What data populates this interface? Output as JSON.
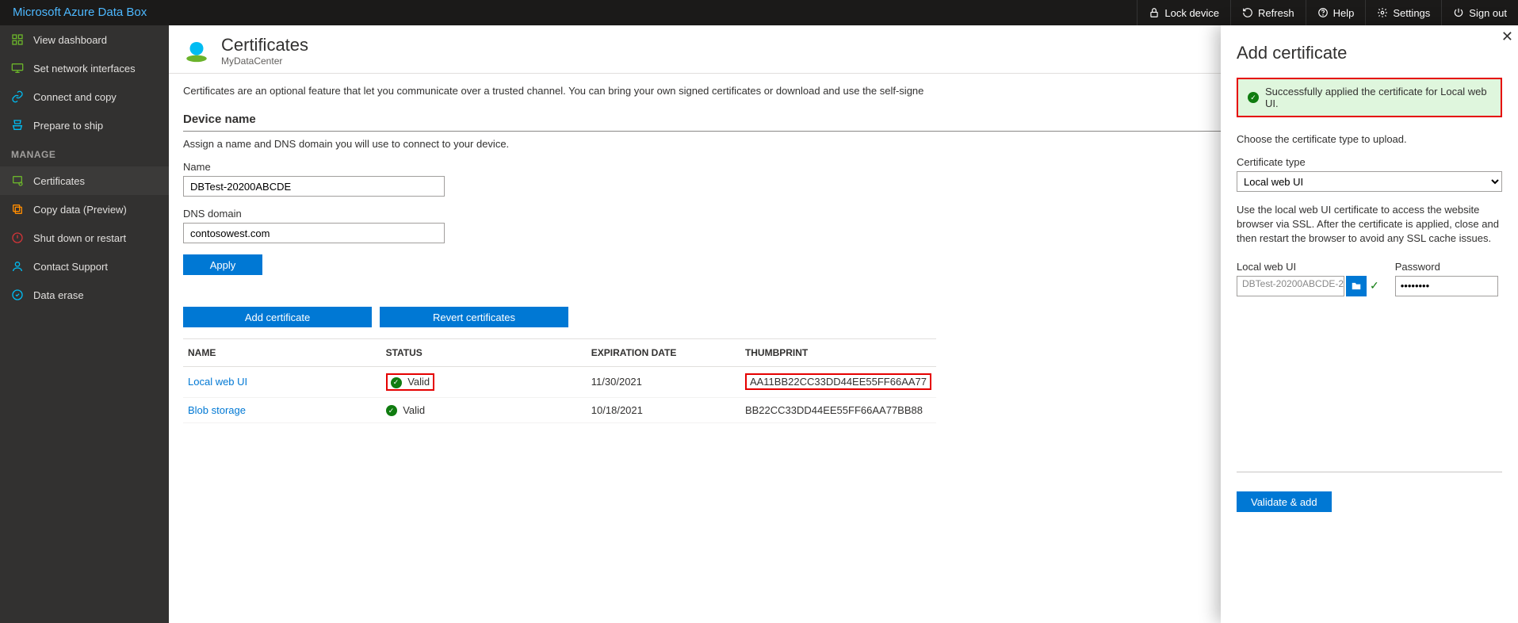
{
  "brand": "Microsoft Azure Data Box",
  "topbar": [
    {
      "label": "Lock device",
      "icon": "lock"
    },
    {
      "label": "Refresh",
      "icon": "refresh"
    },
    {
      "label": "Help",
      "icon": "help"
    },
    {
      "label": "Settings",
      "icon": "settings"
    },
    {
      "label": "Sign out",
      "icon": "signout"
    }
  ],
  "sidebar": {
    "manage_label": "MANAGE",
    "items_top": [
      {
        "label": "View dashboard",
        "icon": "dashboard",
        "color": "#6bb32b"
      },
      {
        "label": "Set network interfaces",
        "icon": "network",
        "color": "#6bb32b"
      },
      {
        "label": "Connect and copy",
        "icon": "chain",
        "color": "#00bcf2"
      },
      {
        "label": "Prepare to ship",
        "icon": "ship",
        "color": "#00bcf2"
      }
    ],
    "items_manage": [
      {
        "label": "Certificates",
        "icon": "cert",
        "color": "#6bb32b",
        "active": true
      },
      {
        "label": "Copy data (Preview)",
        "icon": "copy",
        "color": "#ff8c00"
      },
      {
        "label": "Shut down or restart",
        "icon": "power",
        "color": "#d13438"
      },
      {
        "label": "Contact Support",
        "icon": "support",
        "color": "#00bcf2"
      },
      {
        "label": "Data erase",
        "icon": "erase",
        "color": "#00bcf2"
      }
    ]
  },
  "page": {
    "title": "Certificates",
    "subtitle": "MyDataCenter",
    "intro": "Certificates are an optional feature that let you communicate over a trusted channel. You can bring your own signed certificates or download and use the self-signe",
    "device_section": "Device name",
    "device_desc": "Assign a name and DNS domain you will use to connect to your device.",
    "name_label": "Name",
    "name_value": "DBTest-20200ABCDE",
    "dns_label": "DNS domain",
    "dns_value": "contosowest.com",
    "apply_label": "Apply",
    "add_cert_label": "Add certificate",
    "revert_label": "Revert certificates"
  },
  "table": {
    "headers": {
      "name": "NAME",
      "status": "STATUS",
      "exp": "EXPIRATION DATE",
      "thumb": "THUMBPRINT"
    },
    "rows": [
      {
        "name": "Local web UI",
        "status": "Valid",
        "exp": "11/30/2021",
        "thumb": "AA11BB22CC33DD44EE55FF66AA77",
        "hl": true
      },
      {
        "name": "Blob storage",
        "status": "Valid",
        "exp": "10/18/2021",
        "thumb": "BB22CC33DD44EE55FF66AA77BB88",
        "hl": false
      }
    ]
  },
  "panel": {
    "title": "Add certificate",
    "success_msg": "Successfully applied the certificate for Local web UI.",
    "choose": "Choose the certificate type to upload.",
    "type_label": "Certificate type",
    "type_value": "Local web UI",
    "help": "Use the local web UI certificate to access the website browser via SSL. After the certificate is applied, close and then restart the browser to avoid any SSL cache issues.",
    "file_label": "Local web UI",
    "file_value": "DBTest-20200ABCDE-2",
    "pw_label": "Password",
    "pw_value": "••••••••",
    "validate_label": "Validate & add"
  }
}
